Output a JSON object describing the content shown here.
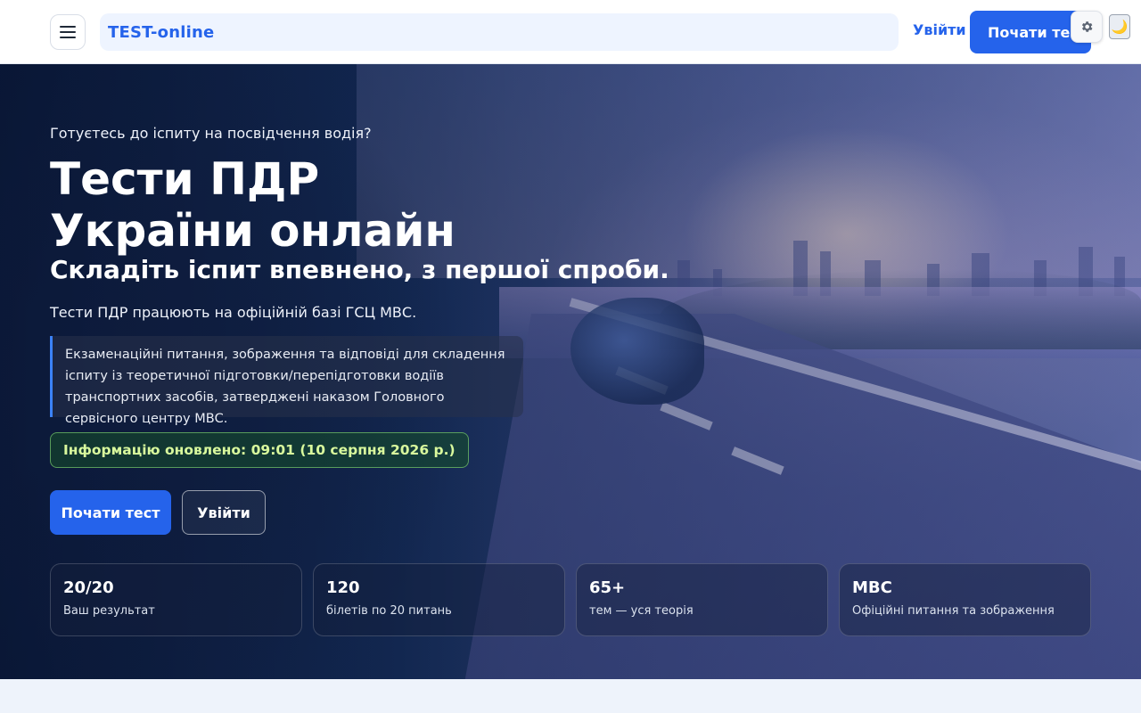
{
  "header": {
    "brand": "TEST-online",
    "login_label": "Увійти",
    "start_label": "Почати тест",
    "menu_icon": "hamburger-menu-icon",
    "settings_icon": "gear-icon",
    "theme_icon": "moon-icon",
    "moon_glyph": "🌙"
  },
  "hero": {
    "kicker": "Готуєтесь до іспиту на посвідчення водія?",
    "title_line1": "Тести ПДР",
    "title_line2": "України онлайн",
    "subtitle": "Складіть іспит впевнено, з першої спроби.",
    "lead": "Тести ПДР працюють на офіційній базі ГСЦ МВС.",
    "quote": "Екзаменаційні питання, зображення та відповіді для складення іспиту із теоретичної підготовки/перепідготовки водіїв транспортних засобів, затверджені наказом Головного сервісного центру МВС.",
    "updated": "Інформацію оновлено: 09:01 (10 серпня 2026 р.)",
    "primary_button": "Почати тест",
    "secondary_button": "Увійти"
  },
  "stats": [
    {
      "value": "20/20",
      "label": "Ваш результат"
    },
    {
      "value": "120",
      "label": "білетів по 20 питань"
    },
    {
      "value": "65+",
      "label": "тем — уся теорія"
    },
    {
      "value": "МВС",
      "label": "Офіційні питання та зображення"
    }
  ],
  "colors": {
    "accent": "#2563eb",
    "updated_text": "#d9f99d",
    "updated_border": "#78c86e"
  }
}
